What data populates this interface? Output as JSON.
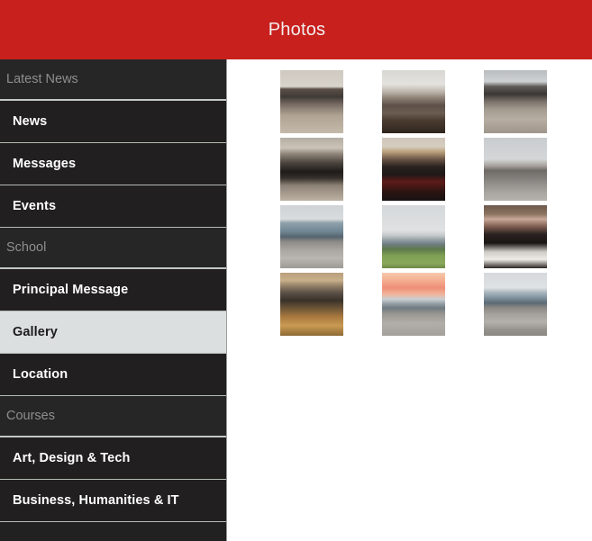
{
  "header": {
    "title": "Photos",
    "background_color": "#c8201d",
    "text_color": "#f2eeee"
  },
  "sidebar": {
    "background_color": "#212121",
    "active_background_color": "#dcdfe0",
    "active_text_color": "#1c1c1c",
    "section_label_color": "#8e8e8e",
    "groups": [
      {
        "section": "Latest News",
        "items": [
          {
            "label": "News",
            "active": false
          },
          {
            "label": "Messages",
            "active": false
          },
          {
            "label": "Events",
            "active": false
          }
        ]
      },
      {
        "section": "School",
        "items": [
          {
            "label": "Principal Message",
            "active": false
          },
          {
            "label": "Gallery",
            "active": true
          },
          {
            "label": "Location",
            "active": false
          }
        ]
      },
      {
        "section": "Courses",
        "items": [
          {
            "label": "Art, Design & Tech",
            "active": false
          },
          {
            "label": "Business, Humanities & IT",
            "active": false
          }
        ]
      }
    ]
  },
  "gallery": {
    "columns": 3,
    "thumbnail_count": 12,
    "thumbnails": [
      {
        "name": "courtyard-tables",
        "alt": "Students sitting at outdoor picnic tables in the courtyard"
      },
      {
        "name": "science-lab",
        "alt": "Two men in white lab coats working with a microscope"
      },
      {
        "name": "canteen-crowd",
        "alt": "Busy covered courtyard crowded with students at tables"
      },
      {
        "name": "craft-bench",
        "alt": "Blonde student working at a craft workbench"
      },
      {
        "name": "hair-salon",
        "alt": "Hairdressing student styling a client with red hair"
      },
      {
        "name": "campus-street",
        "alt": "Road running through the campus under a grey sky"
      },
      {
        "name": "building-road",
        "alt": "Blue-grey school building beside a road with saplings"
      },
      {
        "name": "school-lawn",
        "alt": "Long low school building behind a green lawn"
      },
      {
        "name": "woman-dog",
        "alt": "Smiling woman holding a border collie dog"
      },
      {
        "name": "woodwork-shop",
        "alt": "Three men inspecting a timber gate in a woodwork workshop"
      },
      {
        "name": "sunset-building",
        "alt": "School building silhouetted against a pink sunset sky"
      },
      {
        "name": "school-block",
        "alt": "Modern school block beside a marked car park"
      }
    ]
  }
}
